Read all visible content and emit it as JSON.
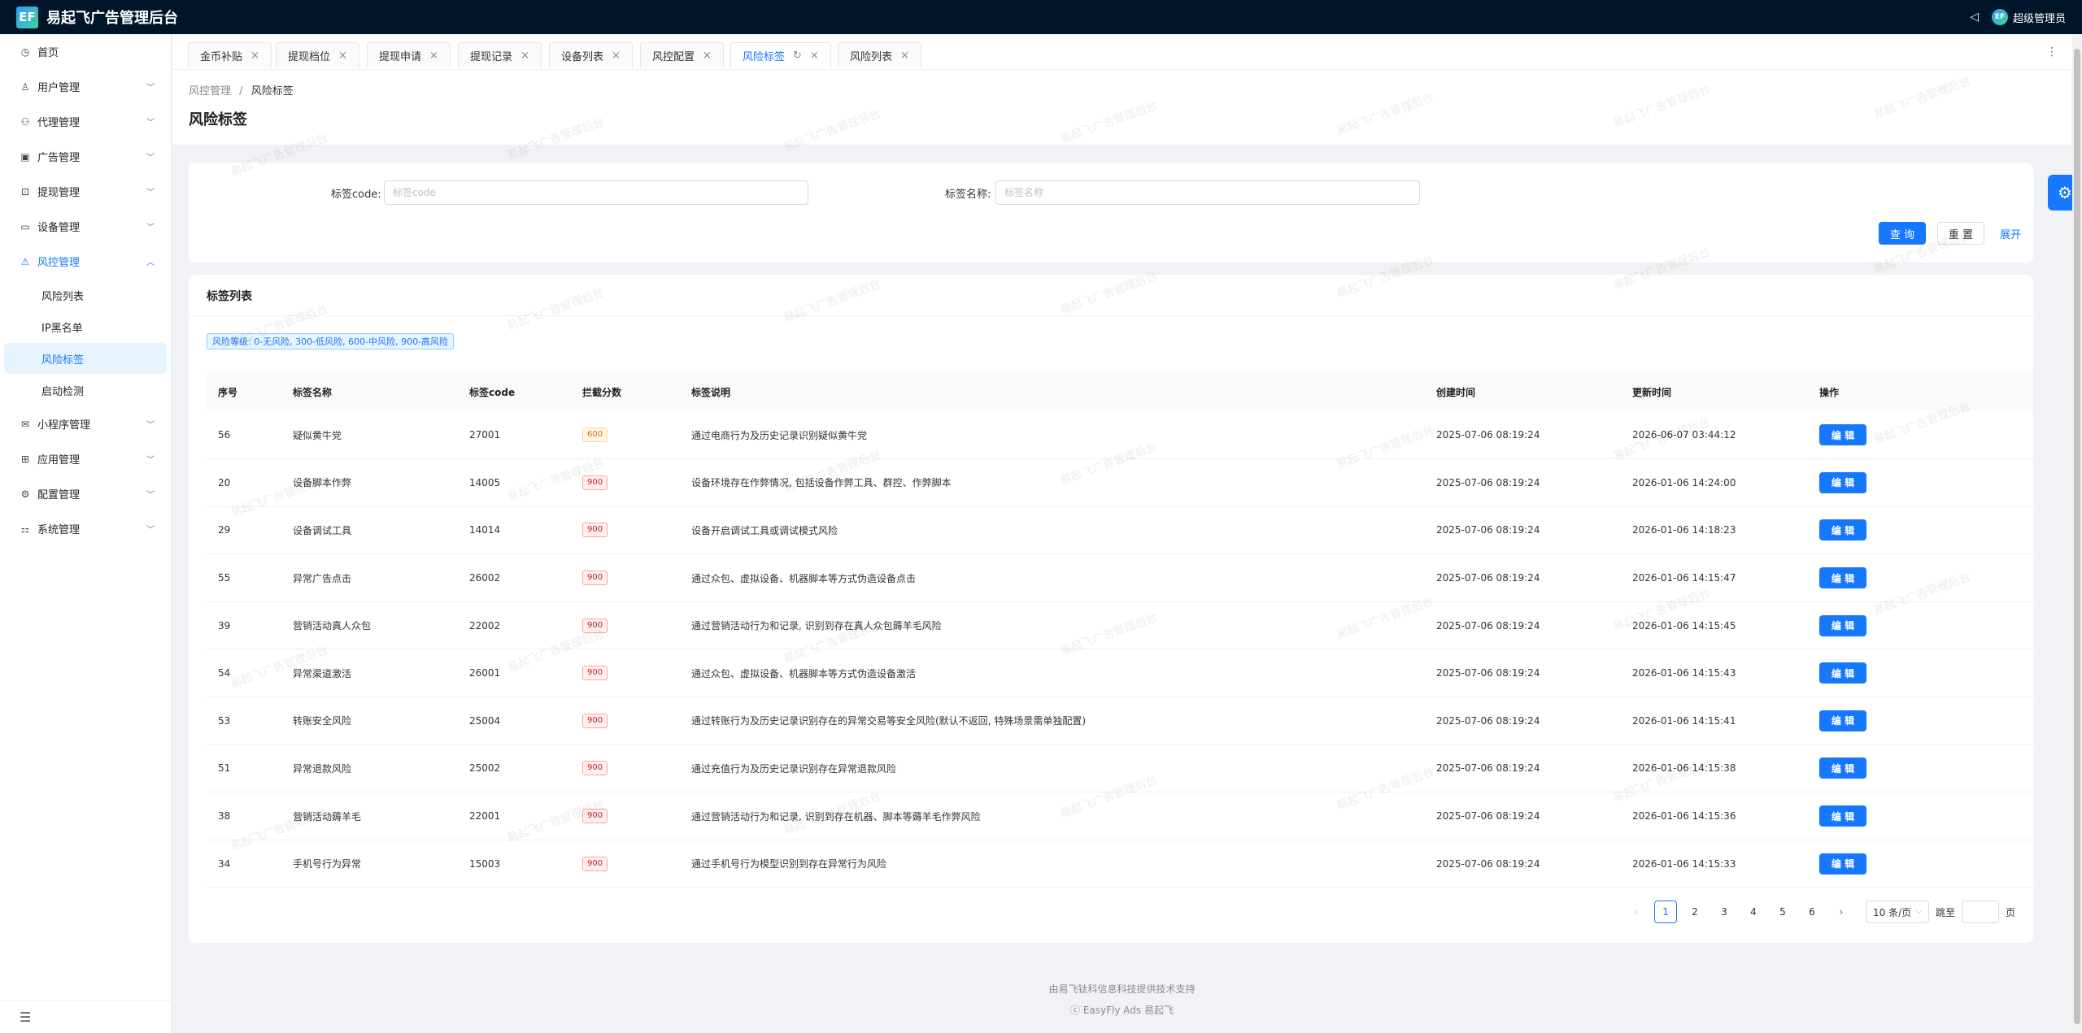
{
  "header": {
    "logo": "EF",
    "app_title": "易起飞广告管理后台",
    "user_avatar": "EF",
    "user_name": "超级管理员"
  },
  "sidebar": {
    "menu": [
      {
        "label": "首页",
        "icon": "dashboard-icon",
        "glyph": "◷"
      },
      {
        "label": "用户管理",
        "icon": "user-icon",
        "glyph": "♙"
      },
      {
        "label": "代理管理",
        "icon": "agent-icon",
        "glyph": "⚇"
      },
      {
        "label": "广告管理",
        "icon": "ad-icon",
        "glyph": "▣"
      },
      {
        "label": "提现管理",
        "icon": "withdraw-icon",
        "glyph": "⊡"
      },
      {
        "label": "设备管理",
        "icon": "device-icon",
        "glyph": "▭"
      },
      {
        "label": "风控管理",
        "icon": "warning-icon",
        "glyph": "⚠"
      }
    ],
    "risk_submenu": [
      "风险列表",
      "IP黑名单",
      "风险标签",
      "启动检测"
    ],
    "menu_after": [
      {
        "label": "小程序管理",
        "icon": "wechat-icon",
        "glyph": "✉"
      },
      {
        "label": "应用管理",
        "icon": "app-icon",
        "glyph": "⊞"
      },
      {
        "label": "配置管理",
        "icon": "config-icon",
        "glyph": "⚙"
      },
      {
        "label": "系统管理",
        "icon": "system-icon",
        "glyph": "⚏"
      }
    ]
  },
  "tabs": [
    "金币补贴",
    "提现档位",
    "提现申请",
    "提现记录",
    "设备列表",
    "风控配置",
    "风险标签",
    "风险列表"
  ],
  "breadcrumb": {
    "parent": "风控管理",
    "separator": "/",
    "current": "风险标签"
  },
  "page_title": "风险标签",
  "search": {
    "code_label": "标签code:",
    "code_placeholder": "标签code",
    "name_label": "标签名称:",
    "name_placeholder": "标签名称",
    "query_button": "查 询",
    "reset_button": "重 置",
    "expand_link": "展开"
  },
  "table_card": {
    "title": "标签列表",
    "risk_level_note": "风险等级: 0-无风险, 300-低风险, 600-中风险, 900-高风险",
    "columns": [
      "序号",
      "标签名称",
      "标签code",
      "拦截分数",
      "标签说明",
      "创建时间",
      "更新时间",
      "操作"
    ],
    "edit_label": "编 辑",
    "rows": [
      {
        "id": "56",
        "name": "疑似黄牛党",
        "code": "27001",
        "score": "600",
        "desc": "通过电商行为及历史记录识别疑似黄牛党",
        "created": "2025-07-06 08:19:24",
        "updated": "2026-06-07 03:44:12"
      },
      {
        "id": "20",
        "name": "设备脚本作弊",
        "code": "14005",
        "score": "900",
        "desc": "设备环境存在作弊情况, 包括设备作弊工具、群控、作弊脚本",
        "created": "2025-07-06 08:19:24",
        "updated": "2026-01-06 14:24:00"
      },
      {
        "id": "29",
        "name": "设备调试工具",
        "code": "14014",
        "score": "900",
        "desc": "设备开启调试工具或调试模式风险",
        "created": "2025-07-06 08:19:24",
        "updated": "2026-01-06 14:18:23"
      },
      {
        "id": "55",
        "name": "异常广告点击",
        "code": "26002",
        "score": "900",
        "desc": "通过众包、虚拟设备、机器脚本等方式伪造设备点击",
        "created": "2025-07-06 08:19:24",
        "updated": "2026-01-06 14:15:47"
      },
      {
        "id": "39",
        "name": "营销活动真人众包",
        "code": "22002",
        "score": "900",
        "desc": "通过营销活动行为和记录, 识别到存在真人众包薅羊毛风险",
        "created": "2025-07-06 08:19:24",
        "updated": "2026-01-06 14:15:45"
      },
      {
        "id": "54",
        "name": "异常渠道激活",
        "code": "26001",
        "score": "900",
        "desc": "通过众包、虚拟设备、机器脚本等方式伪造设备激活",
        "created": "2025-07-06 08:19:24",
        "updated": "2026-01-06 14:15:43"
      },
      {
        "id": "53",
        "name": "转账安全风险",
        "code": "25004",
        "score": "900",
        "desc": "通过转账行为及历史记录识别存在的异常交易等安全风险(默认不返回, 特殊场景需单独配置)",
        "created": "2025-07-06 08:19:24",
        "updated": "2026-01-06 14:15:41"
      },
      {
        "id": "51",
        "name": "异常退款风险",
        "code": "25002",
        "score": "900",
        "desc": "通过充值行为及历史记录识别存在异常退款风险",
        "created": "2025-07-06 08:19:24",
        "updated": "2026-01-06 14:15:38"
      },
      {
        "id": "38",
        "name": "营销活动薅羊毛",
        "code": "22001",
        "score": "900",
        "desc": "通过营销活动行为和记录, 识别到存在机器、脚本等薅羊毛作弊风险",
        "created": "2025-07-06 08:19:24",
        "updated": "2026-01-06 14:15:36"
      },
      {
        "id": "34",
        "name": "手机号行为异常",
        "code": "15003",
        "score": "900",
        "desc": "通过手机号行为模型识别到存在异常行为风险",
        "created": "2025-07-06 08:19:24",
        "updated": "2026-01-06 14:15:33"
      }
    ]
  },
  "pagination": {
    "pages": [
      "1",
      "2",
      "3",
      "4",
      "5",
      "6"
    ],
    "current": "1",
    "page_size": "10 条/页",
    "jump_label": "跳至",
    "page_unit": "页"
  },
  "footer": {
    "support": "由易飞钛科信息科技提供技术支持",
    "brand": "ⓒ EasyFly Ads 易起飞"
  },
  "watermark_text": "易起飞广告管理后台",
  "colors": {
    "primary": "#1677ff",
    "header_bg": "#001529",
    "danger": "#cf1322",
    "warning": "#d46b08"
  }
}
